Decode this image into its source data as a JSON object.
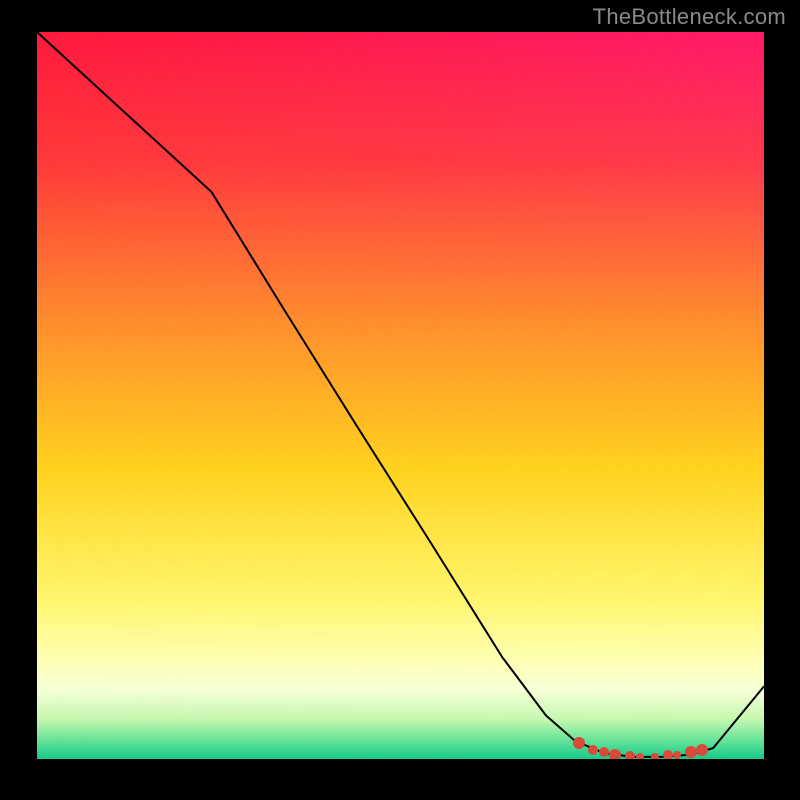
{
  "watermark": "TheBottleneck.com",
  "colors": {
    "marker": "#d84a3a",
    "line": "#000000"
  },
  "chart_data": {
    "type": "line",
    "title": "",
    "xlabel": "",
    "ylabel": "",
    "xlim": [
      0,
      1
    ],
    "ylim": [
      0,
      1
    ],
    "grid": false,
    "legend": false,
    "series": [
      {
        "name": "curve",
        "x": [
          0.0,
          0.12,
          0.24,
          0.34,
          0.44,
          0.54,
          0.64,
          0.7,
          0.74,
          0.78,
          0.82,
          0.86,
          0.9,
          0.93,
          1.0
        ],
        "y": [
          1.0,
          0.89,
          0.78,
          0.618,
          0.458,
          0.3,
          0.14,
          0.06,
          0.025,
          0.008,
          0.003,
          0.003,
          0.006,
          0.015,
          0.1
        ]
      }
    ],
    "markers": {
      "name": "optimal-range",
      "points": [
        {
          "x": 0.745,
          "y": 0.022,
          "r": 6
        },
        {
          "x": 0.765,
          "y": 0.012,
          "r": 5
        },
        {
          "x": 0.78,
          "y": 0.009,
          "r": 5
        },
        {
          "x": 0.795,
          "y": 0.006,
          "r": 6
        },
        {
          "x": 0.815,
          "y": 0.004,
          "r": 5
        },
        {
          "x": 0.83,
          "y": 0.003,
          "r": 4
        },
        {
          "x": 0.85,
          "y": 0.003,
          "r": 4
        },
        {
          "x": 0.868,
          "y": 0.005,
          "r": 5
        },
        {
          "x": 0.88,
          "y": 0.006,
          "r": 4
        },
        {
          "x": 0.9,
          "y": 0.01,
          "r": 6
        },
        {
          "x": 0.915,
          "y": 0.013,
          "r": 6
        }
      ]
    }
  }
}
